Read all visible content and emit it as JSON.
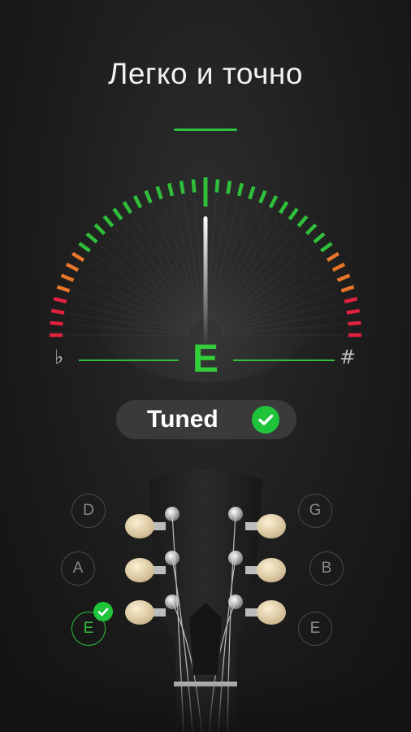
{
  "headline": "Легко и точно",
  "tuner": {
    "note": "E",
    "flat_symbol": "♭",
    "sharp_symbol": "#",
    "deviation_cents": 0,
    "status_label": "Tuned",
    "status_icon": "check-circle-icon"
  },
  "strings": {
    "left": [
      {
        "label": "D",
        "tuned": false
      },
      {
        "label": "A",
        "tuned": false
      },
      {
        "label": "E",
        "tuned": true
      }
    ],
    "right": [
      {
        "label": "G",
        "tuned": false
      },
      {
        "label": "B",
        "tuned": false
      },
      {
        "label": "E",
        "tuned": false
      }
    ]
  },
  "colors": {
    "in_tune": "#2fbf3a",
    "warning": "#e8762a",
    "off": "#e0223f",
    "text": "#f2f2f2",
    "pill_bg": "#3a3a3a"
  }
}
